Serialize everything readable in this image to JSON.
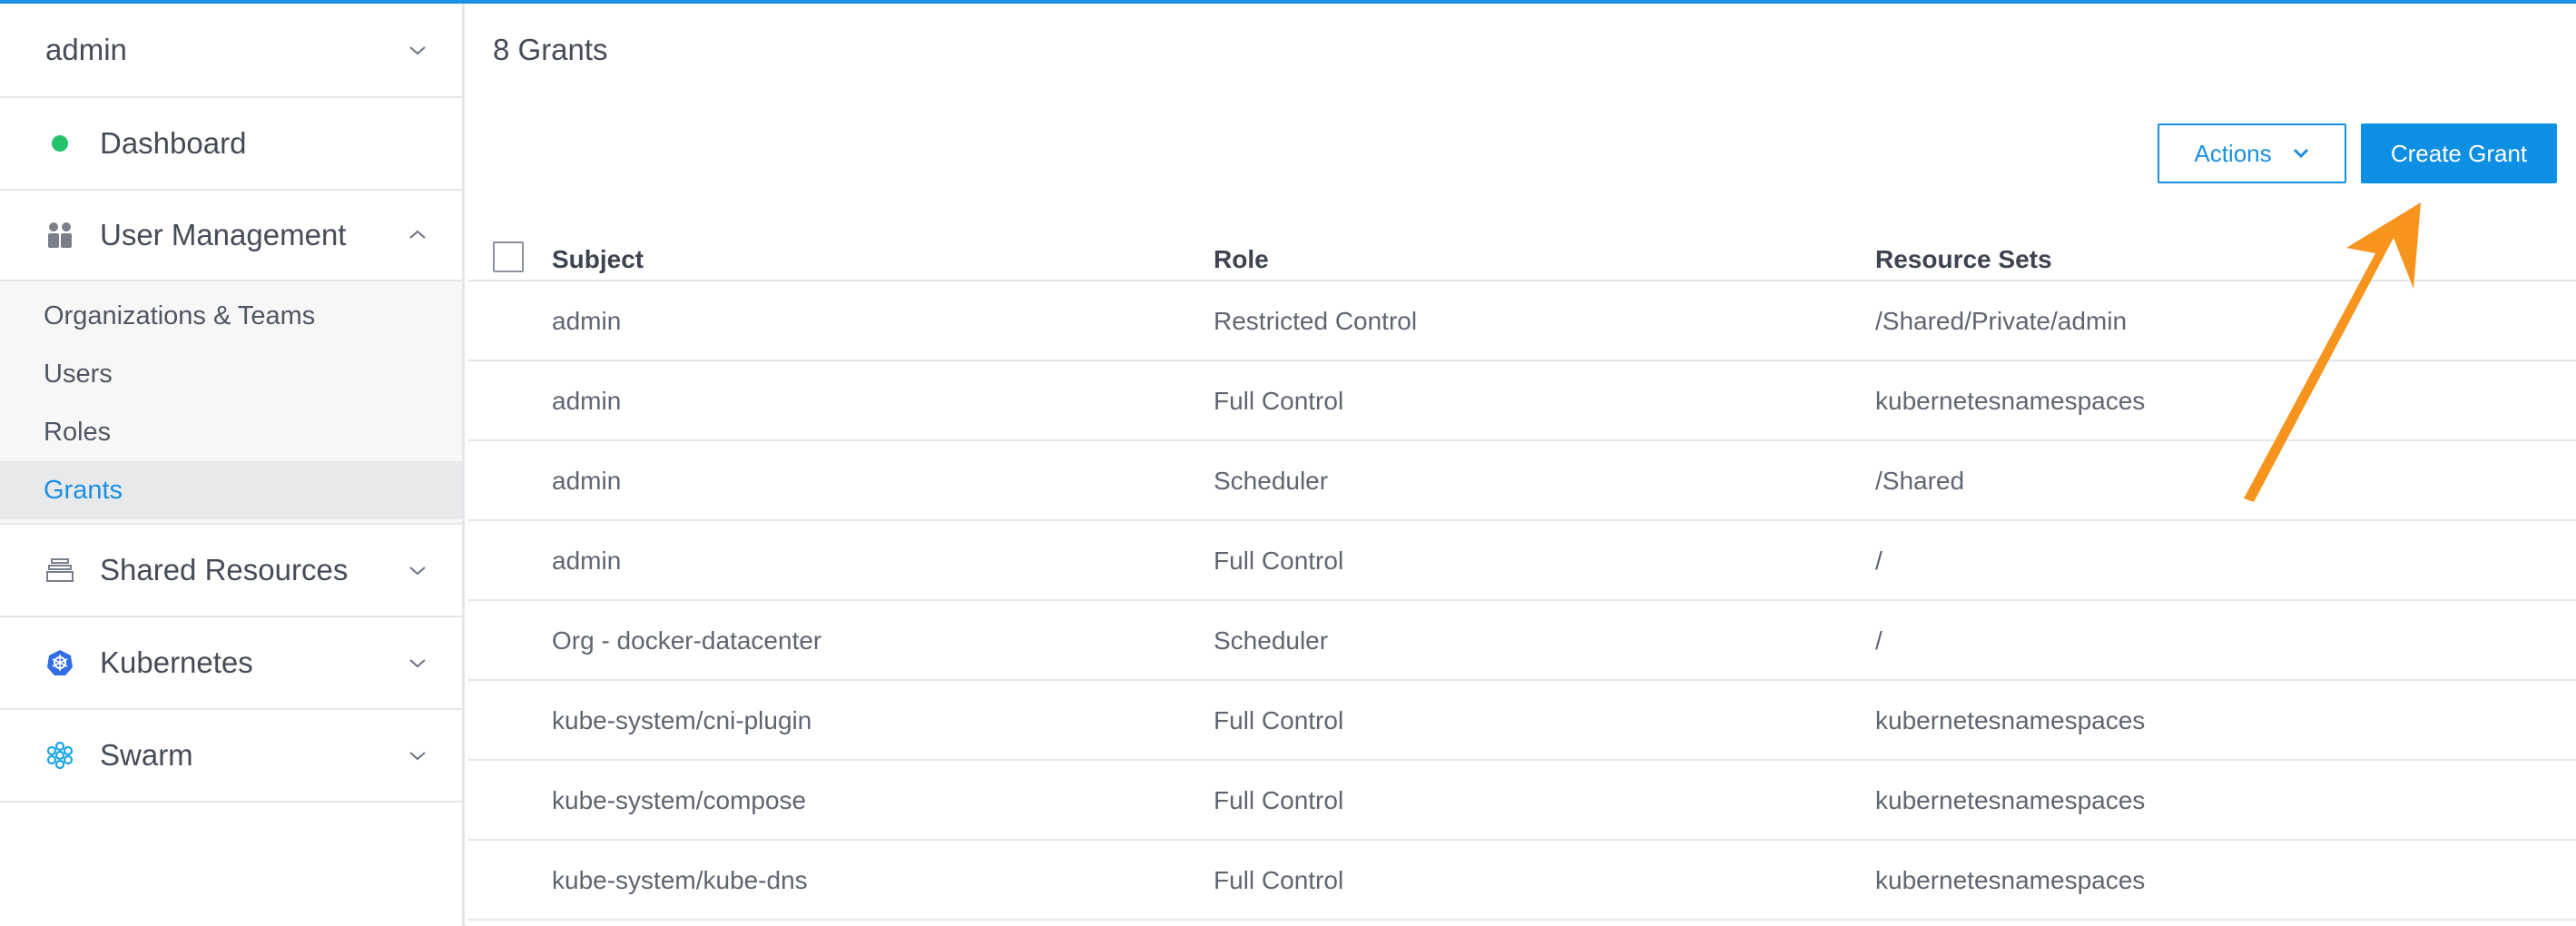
{
  "sidebar": {
    "user": "admin",
    "items": [
      {
        "label": "Dashboard"
      },
      {
        "label": "User Management"
      },
      {
        "label": "Shared Resources"
      },
      {
        "label": "Kubernetes"
      },
      {
        "label": "Swarm"
      }
    ],
    "subitems": [
      {
        "label": "Organizations & Teams"
      },
      {
        "label": "Users"
      },
      {
        "label": "Roles"
      },
      {
        "label": "Grants"
      }
    ]
  },
  "main": {
    "title": "8 Grants",
    "actions_label": "Actions",
    "create_label": "Create Grant",
    "table": {
      "headers": [
        "Subject",
        "Role",
        "Resource Sets"
      ],
      "rows": [
        [
          "admin",
          "Restricted Control",
          "/Shared/Private/admin"
        ],
        [
          "admin",
          "Full Control",
          "kubernetesnamespaces"
        ],
        [
          "admin",
          "Scheduler",
          "/Shared"
        ],
        [
          "admin",
          "Full Control",
          "/"
        ],
        [
          "Org - docker-datacenter",
          "Scheduler",
          "/"
        ],
        [
          "kube-system/cni-plugin",
          "Full Control",
          "kubernetesnamespaces"
        ],
        [
          "kube-system/compose",
          "Full Control",
          "kubernetesnamespaces"
        ],
        [
          "kube-system/kube-dns",
          "Full Control",
          "kubernetesnamespaces"
        ]
      ]
    }
  },
  "colors": {
    "accent": "#1a8fe3",
    "status_green": "#22c36b",
    "annotation_arrow": "#f7941d"
  },
  "icons": {
    "dashboard": "status-dot-icon",
    "user_management": "users-icon",
    "shared_resources": "stack-icon",
    "kubernetes": "kubernetes-icon",
    "swarm": "swarm-icon"
  }
}
